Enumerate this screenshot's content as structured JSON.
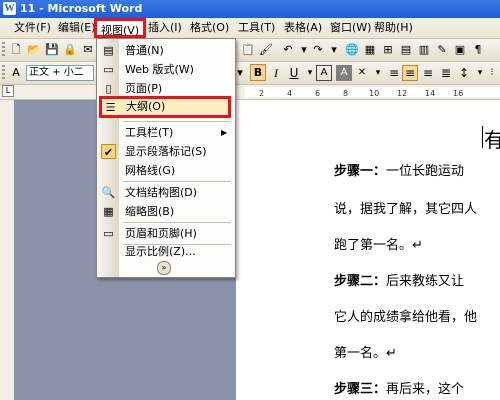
{
  "window": {
    "title": "11 - Microsoft Word"
  },
  "menubar": {
    "items": [
      "文件(F)",
      "编辑(E)",
      "视图(V)",
      "插入(I)",
      "格式(O)",
      "工具(T)",
      "表格(A)",
      "窗口(W)",
      "帮助(H)"
    ],
    "active": "视图(V)"
  },
  "formatting": {
    "style": "正文 + 小二"
  },
  "ruler": {
    "ticks": [
      "2",
      "4",
      "6",
      "8",
      "10",
      "12",
      "14",
      "16"
    ]
  },
  "view_menu": {
    "items": [
      {
        "label": "普通(N)",
        "icon": "normal-view-icon"
      },
      {
        "label": "Web 版式(W)",
        "icon": "web-layout-icon"
      },
      {
        "label": "页面(P)",
        "icon": "page-layout-icon"
      },
      {
        "label": "大纲(O)",
        "icon": "outline-view-icon",
        "highlighted": true
      },
      {
        "label": "工具栏(T)",
        "submenu": true
      },
      {
        "label": "显示段落标记(S)",
        "checked": true
      },
      {
        "label": "网格线(G)"
      },
      {
        "label": "文档结构图(D)",
        "icon": "document-map-icon"
      },
      {
        "label": "缩略图(B)",
        "icon": "thumbnails-icon"
      },
      {
        "label": "页眉和页脚(H)",
        "icon": "header-footer-icon"
      },
      {
        "label": "显示比例(Z)..."
      }
    ]
  },
  "document": {
    "title": "有",
    "lines": [
      {
        "bold": "步骤一：",
        "text": "一位长跑运动"
      },
      {
        "bold": "",
        "text": "说，据我了解，其它四人"
      },
      {
        "bold": "",
        "text": "跑了第一名。↵"
      },
      {
        "bold": "步骤二：",
        "text": "后来教练又让"
      },
      {
        "bold": "",
        "text": "它人的成绩拿给他看，他"
      },
      {
        "bold": "",
        "text": "第一名。↵"
      },
      {
        "bold": "步骤三：",
        "text": "再后来，这个"
      }
    ]
  }
}
